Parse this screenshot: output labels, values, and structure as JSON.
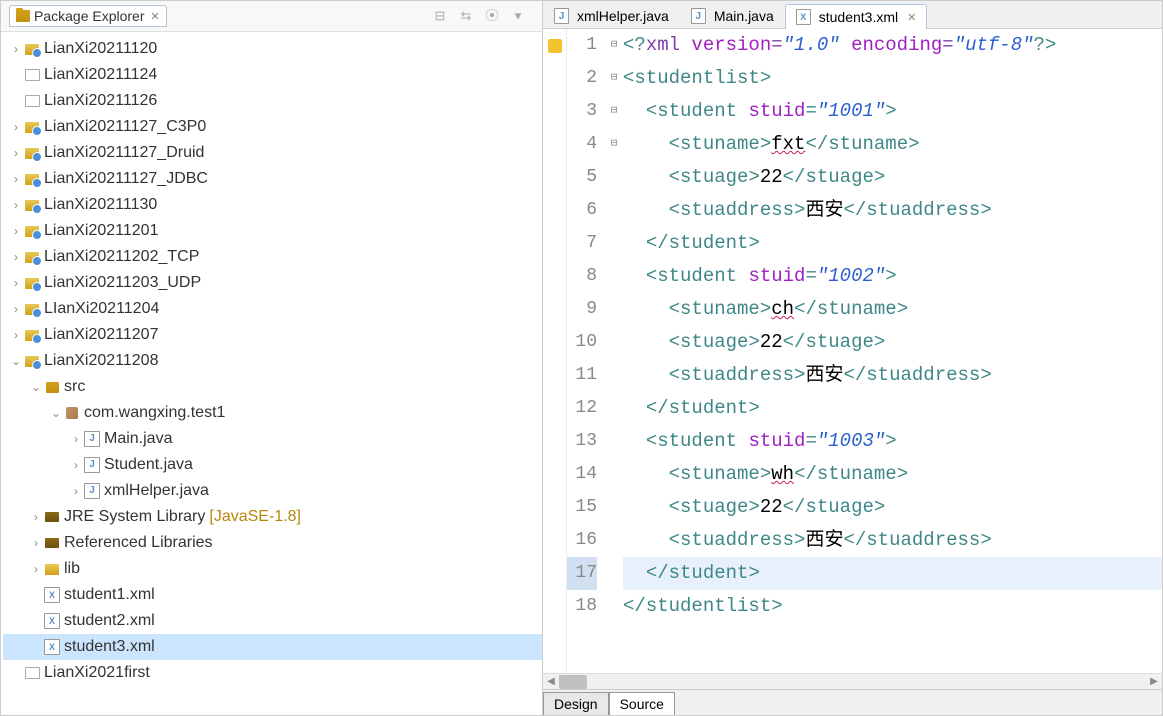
{
  "explorer": {
    "title": "Package Explorer",
    "items": [
      {
        "label": "LianXi20211120",
        "icon": "proj",
        "depth": 0,
        "expand": "closed"
      },
      {
        "label": "LianXi20211124",
        "icon": "folder-closed",
        "depth": 0,
        "expand": "none"
      },
      {
        "label": "LianXi20211126",
        "icon": "folder-closed",
        "depth": 0,
        "expand": "none"
      },
      {
        "label": "LianXi20211127_C3P0",
        "icon": "proj",
        "depth": 0,
        "expand": "closed"
      },
      {
        "label": "LianXi20211127_Druid",
        "icon": "proj",
        "depth": 0,
        "expand": "closed"
      },
      {
        "label": "LianXi20211127_JDBC",
        "icon": "proj",
        "depth": 0,
        "expand": "closed"
      },
      {
        "label": "LianXi20211130",
        "icon": "proj",
        "depth": 0,
        "expand": "closed"
      },
      {
        "label": "LianXi20211201",
        "icon": "proj",
        "depth": 0,
        "expand": "closed"
      },
      {
        "label": "LianXi20211202_TCP",
        "icon": "proj",
        "depth": 0,
        "expand": "closed"
      },
      {
        "label": "LianXi20211203_UDP",
        "icon": "proj",
        "depth": 0,
        "expand": "closed"
      },
      {
        "label": "LIanXi20211204",
        "icon": "proj",
        "depth": 0,
        "expand": "closed"
      },
      {
        "label": "LianXi20211207",
        "icon": "proj",
        "depth": 0,
        "expand": "closed"
      },
      {
        "label": "LianXi20211208",
        "icon": "proj",
        "depth": 0,
        "expand": "open"
      },
      {
        "label": "src",
        "icon": "src",
        "depth": 1,
        "expand": "open"
      },
      {
        "label": "com.wangxing.test1",
        "icon": "pkg",
        "depth": 2,
        "expand": "open"
      },
      {
        "label": "Main.java",
        "icon": "java",
        "depth": 3,
        "expand": "closed"
      },
      {
        "label": "Student.java",
        "icon": "java",
        "depth": 3,
        "expand": "closed"
      },
      {
        "label": "xmlHelper.java",
        "icon": "java",
        "depth": 3,
        "expand": "closed"
      },
      {
        "label": "JRE System Library",
        "suffix": "[JavaSE-1.8]",
        "icon": "lib",
        "depth": 1,
        "expand": "closed"
      },
      {
        "label": "Referenced Libraries",
        "icon": "lib",
        "depth": 1,
        "expand": "closed"
      },
      {
        "label": "lib",
        "icon": "folder",
        "depth": 1,
        "expand": "closed"
      },
      {
        "label": "student1.xml",
        "icon": "xml",
        "depth": 1,
        "expand": "none"
      },
      {
        "label": "student2.xml",
        "icon": "xml",
        "depth": 1,
        "expand": "none"
      },
      {
        "label": "student3.xml",
        "icon": "xml",
        "depth": 1,
        "expand": "none",
        "selected": true
      },
      {
        "label": "LianXi2021first",
        "icon": "folder-closed",
        "depth": 0,
        "expand": "none"
      }
    ]
  },
  "tabs": [
    {
      "label": "xmlHelper.java",
      "icon": "java",
      "active": false
    },
    {
      "label": "Main.java",
      "icon": "java",
      "active": false
    },
    {
      "label": "student3.xml",
      "icon": "xml",
      "active": true
    }
  ],
  "editor": {
    "highlighted_line": 17,
    "lines": [
      {
        "n": 1,
        "warn": true,
        "fold": "",
        "tokens": [
          [
            "teal",
            "<?"
          ],
          [
            "purple",
            "xml "
          ],
          [
            "attr",
            "version"
          ],
          [
            "purple",
            "="
          ],
          [
            "str",
            "\"1.0\""
          ],
          [
            "purple",
            " "
          ],
          [
            "attr",
            "encoding"
          ],
          [
            "purple",
            "="
          ],
          [
            "str",
            "\"utf-8\""
          ],
          [
            "teal",
            "?>"
          ]
        ]
      },
      {
        "n": 2,
        "fold": "-",
        "tokens": [
          [
            "teal",
            "<"
          ],
          [
            "teal",
            "studentlist"
          ],
          [
            "teal",
            ">"
          ]
        ]
      },
      {
        "n": 3,
        "fold": "-",
        "indent": 1,
        "tokens": [
          [
            "teal",
            "<"
          ],
          [
            "teal",
            "student "
          ],
          [
            "attr",
            "stuid"
          ],
          [
            "teal",
            "="
          ],
          [
            "str",
            "\"1001\""
          ],
          [
            "teal",
            ">"
          ]
        ]
      },
      {
        "n": 4,
        "indent": 2,
        "tokens": [
          [
            "teal",
            "<"
          ],
          [
            "teal",
            "stuname"
          ],
          [
            "teal",
            ">"
          ],
          [
            "text-wavy",
            "fxt"
          ],
          [
            "teal",
            "</"
          ],
          [
            "teal",
            "stuname"
          ],
          [
            "teal",
            ">"
          ]
        ]
      },
      {
        "n": 5,
        "indent": 2,
        "tokens": [
          [
            "teal",
            "<"
          ],
          [
            "teal",
            "stuage"
          ],
          [
            "teal",
            ">"
          ],
          [
            "text",
            "22"
          ],
          [
            "teal",
            "</"
          ],
          [
            "teal",
            "stuage"
          ],
          [
            "teal",
            ">"
          ]
        ]
      },
      {
        "n": 6,
        "indent": 2,
        "tokens": [
          [
            "teal",
            "<"
          ],
          [
            "teal",
            "stuaddress"
          ],
          [
            "teal",
            ">"
          ],
          [
            "text",
            "西安"
          ],
          [
            "teal",
            "</"
          ],
          [
            "teal",
            "stuaddress"
          ],
          [
            "teal",
            ">"
          ]
        ]
      },
      {
        "n": 7,
        "indent": 1,
        "tokens": [
          [
            "teal",
            "</"
          ],
          [
            "teal",
            "student"
          ],
          [
            "teal",
            ">"
          ]
        ]
      },
      {
        "n": 8,
        "fold": "-",
        "indent": 1,
        "tokens": [
          [
            "teal",
            "<"
          ],
          [
            "teal",
            "student "
          ],
          [
            "attr",
            "stuid"
          ],
          [
            "teal",
            "="
          ],
          [
            "str",
            "\"1002\""
          ],
          [
            "teal",
            ">"
          ]
        ]
      },
      {
        "n": 9,
        "indent": 2,
        "tokens": [
          [
            "teal",
            "<"
          ],
          [
            "teal",
            "stuname"
          ],
          [
            "teal",
            ">"
          ],
          [
            "text-wavy",
            "ch"
          ],
          [
            "teal",
            "</"
          ],
          [
            "teal",
            "stuname"
          ],
          [
            "teal",
            ">"
          ]
        ]
      },
      {
        "n": 10,
        "indent": 2,
        "tokens": [
          [
            "teal",
            "<"
          ],
          [
            "teal",
            "stuage"
          ],
          [
            "teal",
            ">"
          ],
          [
            "text",
            "22"
          ],
          [
            "teal",
            "</"
          ],
          [
            "teal",
            "stuage"
          ],
          [
            "teal",
            ">"
          ]
        ]
      },
      {
        "n": 11,
        "indent": 2,
        "tokens": [
          [
            "teal",
            "<"
          ],
          [
            "teal",
            "stuaddress"
          ],
          [
            "teal",
            ">"
          ],
          [
            "text",
            "西安"
          ],
          [
            "teal",
            "</"
          ],
          [
            "teal",
            "stuaddress"
          ],
          [
            "teal",
            ">"
          ]
        ]
      },
      {
        "n": 12,
        "indent": 1,
        "tokens": [
          [
            "teal",
            "</"
          ],
          [
            "teal",
            "student"
          ],
          [
            "teal",
            ">"
          ]
        ]
      },
      {
        "n": 13,
        "fold": "-",
        "indent": 1,
        "tokens": [
          [
            "teal",
            "<"
          ],
          [
            "teal",
            "student "
          ],
          [
            "attr",
            "stuid"
          ],
          [
            "teal",
            "="
          ],
          [
            "str",
            "\"1003\""
          ],
          [
            "teal",
            ">"
          ]
        ]
      },
      {
        "n": 14,
        "indent": 2,
        "tokens": [
          [
            "teal",
            "<"
          ],
          [
            "teal",
            "stuname"
          ],
          [
            "teal",
            ">"
          ],
          [
            "text-wavy",
            "wh"
          ],
          [
            "teal",
            "</"
          ],
          [
            "teal",
            "stuname"
          ],
          [
            "teal",
            ">"
          ]
        ]
      },
      {
        "n": 15,
        "indent": 2,
        "tokens": [
          [
            "teal",
            "<"
          ],
          [
            "teal",
            "stuage"
          ],
          [
            "teal",
            ">"
          ],
          [
            "text",
            "22"
          ],
          [
            "teal",
            "</"
          ],
          [
            "teal",
            "stuage"
          ],
          [
            "teal",
            ">"
          ]
        ]
      },
      {
        "n": 16,
        "indent": 2,
        "tokens": [
          [
            "teal",
            "<"
          ],
          [
            "teal",
            "stuaddress"
          ],
          [
            "teal",
            ">"
          ],
          [
            "text",
            "西安"
          ],
          [
            "teal",
            "</"
          ],
          [
            "teal",
            "stuaddress"
          ],
          [
            "teal",
            ">"
          ]
        ]
      },
      {
        "n": 17,
        "indent": 1,
        "tokens": [
          [
            "teal",
            "</"
          ],
          [
            "teal",
            "student"
          ],
          [
            "teal",
            ">"
          ]
        ]
      },
      {
        "n": 18,
        "tokens": [
          [
            "teal",
            "</"
          ],
          [
            "teal",
            "studentlist"
          ],
          [
            "teal",
            ">"
          ]
        ]
      }
    ]
  },
  "bottom_tabs": {
    "design": "Design",
    "source": "Source",
    "active": "source"
  }
}
